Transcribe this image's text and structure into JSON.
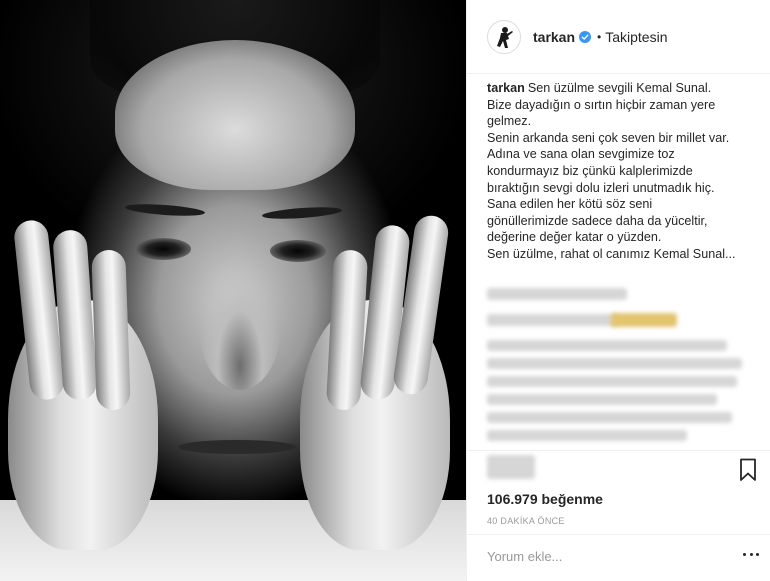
{
  "post": {
    "author": {
      "username": "tarkan",
      "verified": true,
      "separator": "•",
      "follow_status": "Takiptesin"
    },
    "caption": {
      "username": "tarkan",
      "lines": [
        "Sen üzülme sevgili Kemal Sunal.",
        "Bize dayadığın o sırtın hiçbir zaman yere",
        "gelmez.",
        "Senin arkanda seni çok seven bir millet var.",
        "Adına ve sana olan sevgimize toz",
        "kondurmayız biz çünkü kalplerimizde",
        "bıraktığın sevgi dolu izleri unutmadık hiç.",
        "Sana edilen her kötü söz seni",
        "gönüllerimizde sadece daha da yüceltir,",
        "değerine değer katar o yüzden.",
        "Sen üzülme, rahat ol canımız Kemal Sunal..."
      ]
    },
    "likes": "106.979 beğenme",
    "timestamp": "40 DAKİKA ÖNCE",
    "comment": {
      "placeholder": "Yorum ekle..."
    },
    "icons": {
      "avatar": "avatar-icon",
      "verified": "verified-badge-icon",
      "bookmark": "bookmark-icon",
      "more": "more-options-icon"
    },
    "colors": {
      "text": "#262626",
      "muted": "#999999",
      "verified": "#3897f0",
      "border": "#efefef"
    }
  }
}
